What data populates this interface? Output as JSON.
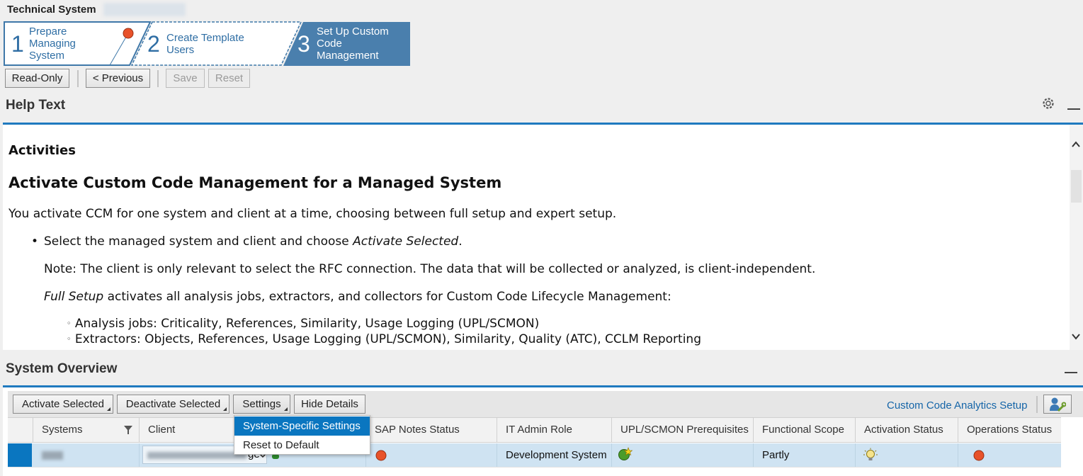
{
  "header": {
    "title": "Technical System"
  },
  "roadmap": {
    "steps": [
      {
        "number": "1",
        "line1": "Prepare",
        "line2": "Managing",
        "line3": "System",
        "state": "visited"
      },
      {
        "number": "2",
        "line1": "Create Template",
        "line2": "Users",
        "state": "visited"
      },
      {
        "number": "3",
        "line1": "Set Up Custom",
        "line2": "Code",
        "line3": "Management",
        "state": "current"
      }
    ]
  },
  "toolbar": {
    "readonly_label": "Read-Only",
    "previous_label": "< Previous",
    "save_label": "Save",
    "reset_label": "Reset"
  },
  "help": {
    "title": "Help Text",
    "activities": "Activities",
    "heading": "Activate Custom Code Management for a Managed System",
    "intro": "You activate CCM for one system and client at a time, choosing between full setup and expert setup.",
    "bullet_pre": "Select the managed system and client and choose ",
    "bullet_em": "Activate Selected",
    "bullet_post": ".",
    "note": "Note: The client is only relevant to select the RFC connection. The data that will be collected or analyzed, is client-independent.",
    "full_em": "Full Setup",
    "full_post": " activates all analysis jobs, extractors, and collectors for Custom Code Lifecycle Management:",
    "sub1": "Analysis jobs: Criticality, References, Similarity, Usage Logging (UPL/SCMON)",
    "sub2": "Extractors: Objects, References, Usage Logging (UPL/SCMON), Similarity, Quality (ATC), CCLM Reporting"
  },
  "overview": {
    "title": "System Overview",
    "activate_label": "Activate Selected",
    "deactivate_label": "Deactivate Selected",
    "settings_label": "Settings",
    "hide_label": "Hide Details",
    "analytics_link": "Custom Code Analytics Setup",
    "columns": [
      "Systems",
      "Client",
      "SAP Notes Status",
      "IT Admin Role",
      "UPL/SCMON Prerequisites",
      "Functional Scope",
      "Activation Status",
      "Operations Status"
    ],
    "row": {
      "client_partial": "ge",
      "it_admin_role": "Development System",
      "functional_scope": "Partly"
    },
    "menu": {
      "item1": "System-Specific Settings",
      "item2": "Reset to Default"
    }
  },
  "colors": {
    "accent": "#1f7abf",
    "roadmap_current": "#4a7fad",
    "selection": "#0a76c0",
    "status_red": "#e8522a"
  }
}
